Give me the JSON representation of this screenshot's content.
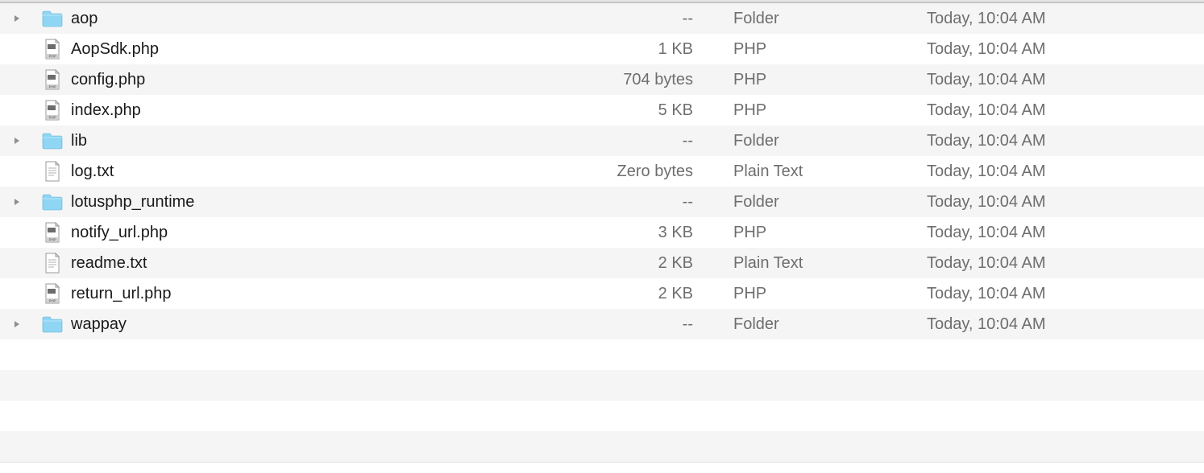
{
  "rows": [
    {
      "name": "aop",
      "size": "--",
      "kind": "Folder",
      "date": "Today, 10:04 AM",
      "icon": "folder",
      "disclosure": true
    },
    {
      "name": "AopSdk.php",
      "size": "1 KB",
      "kind": "PHP",
      "date": "Today, 10:04 AM",
      "icon": "php",
      "disclosure": false
    },
    {
      "name": "config.php",
      "size": "704 bytes",
      "kind": "PHP",
      "date": "Today, 10:04 AM",
      "icon": "php",
      "disclosure": false
    },
    {
      "name": "index.php",
      "size": "5 KB",
      "kind": "PHP",
      "date": "Today, 10:04 AM",
      "icon": "php",
      "disclosure": false
    },
    {
      "name": "lib",
      "size": "--",
      "kind": "Folder",
      "date": "Today, 10:04 AM",
      "icon": "folder",
      "disclosure": true
    },
    {
      "name": "log.txt",
      "size": "Zero bytes",
      "kind": "Plain Text",
      "date": "Today, 10:04 AM",
      "icon": "txt",
      "disclosure": false
    },
    {
      "name": "lotusphp_runtime",
      "size": "--",
      "kind": "Folder",
      "date": "Today, 10:04 AM",
      "icon": "folder",
      "disclosure": true
    },
    {
      "name": "notify_url.php",
      "size": "3 KB",
      "kind": "PHP",
      "date": "Today, 10:04 AM",
      "icon": "php",
      "disclosure": false
    },
    {
      "name": "readme.txt",
      "size": "2 KB",
      "kind": "Plain Text",
      "date": "Today, 10:04 AM",
      "icon": "txt",
      "disclosure": false
    },
    {
      "name": "return_url.php",
      "size": "2 KB",
      "kind": "PHP",
      "date": "Today, 10:04 AM",
      "icon": "php",
      "disclosure": false
    },
    {
      "name": "wappay",
      "size": "--",
      "kind": "Folder",
      "date": "Today, 10:04 AM",
      "icon": "folder",
      "disclosure": true
    }
  ],
  "trailing_empty_rows": 4
}
